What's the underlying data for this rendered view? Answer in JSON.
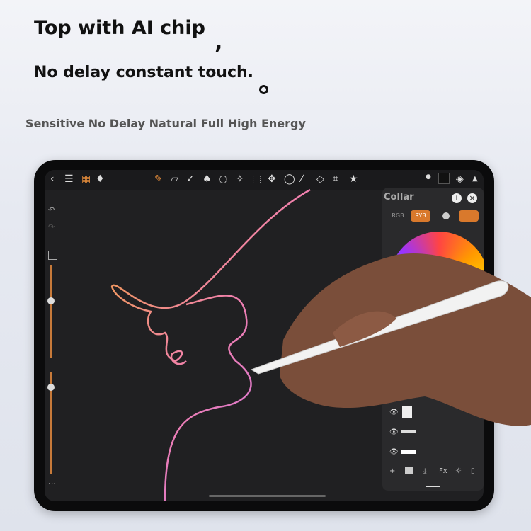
{
  "headline": "Top with AI chip",
  "headline_punct": ",",
  "subheadline": "No delay constant touch.",
  "tagline": "Sensitive No Delay Natural Full High Energy",
  "app": {
    "toolbar_icons": [
      "back-icon",
      "menu-icon",
      "gallery-icon",
      "adjust-icon",
      "brush-icon",
      "eraser-icon",
      "smudge-icon",
      "fill-icon",
      "lasso-icon",
      "selection-icon",
      "rect-select-icon",
      "move-icon",
      "ellipse-select-icon",
      "magic-wand-icon",
      "transform-icon",
      "crop-icon",
      "star-icon"
    ],
    "panel": {
      "title": "Collar",
      "modes": [
        "RGB",
        "RYB"
      ],
      "add": "+",
      "close": "×"
    },
    "layer_bar": {
      "fx": "Fx",
      "add": "+"
    },
    "accent": "#d9792c"
  }
}
